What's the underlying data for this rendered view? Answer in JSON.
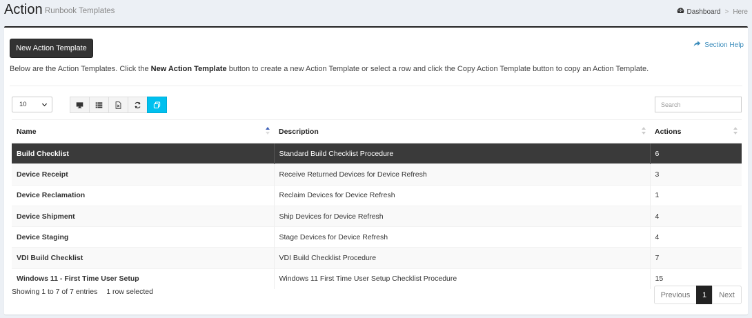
{
  "header": {
    "title": "Action",
    "subtitle": "Runbook Templates",
    "breadcrumb": {
      "dashboard": "Dashboard",
      "separator": ">",
      "current": "Here"
    }
  },
  "toolbar": {
    "new_button": "New Action Template",
    "help_link": "Section Help"
  },
  "intro": {
    "before": "Below are the Action Templates. Click the ",
    "bold": "New Action Template",
    "after": " button to create a new Action Template or select a row and click the Copy Action Template button to copy an Action Template."
  },
  "controls": {
    "page_length": "10",
    "search_placeholder": "Search",
    "icons": [
      "monitor-icon",
      "list-icon",
      "excel-icon",
      "refresh-icon",
      "copy-icon"
    ],
    "accent_color": "#00c0ef"
  },
  "table": {
    "columns": [
      "Name",
      "Description",
      "Actions"
    ],
    "rows": [
      {
        "name": "Build Checklist",
        "description": "Standard Build Checklist Procedure",
        "actions": "6",
        "selected": true
      },
      {
        "name": "Device Receipt",
        "description": "Receive Returned Devices for Device Refresh",
        "actions": "3"
      },
      {
        "name": "Device Reclamation",
        "description": "Reclaim Devices for Device Refresh",
        "actions": "1"
      },
      {
        "name": "Device Shipment",
        "description": "Ship Devices for Device Refresh",
        "actions": "4"
      },
      {
        "name": "Device Staging",
        "description": "Stage Devices for Device Refresh",
        "actions": "4"
      },
      {
        "name": "VDI Build Checklist",
        "description": "VDI Build Checklist Procedure",
        "actions": "7"
      },
      {
        "name": "Windows 11 - First Time User Setup",
        "description": "Windows 11 First Time User Setup Checklist Procedure",
        "actions": "15"
      }
    ]
  },
  "footer": {
    "info": "Showing 1 to 7 of 7 entries",
    "selected": "1 row selected",
    "pagination": {
      "previous": "Previous",
      "current": "1",
      "next": "Next"
    }
  }
}
